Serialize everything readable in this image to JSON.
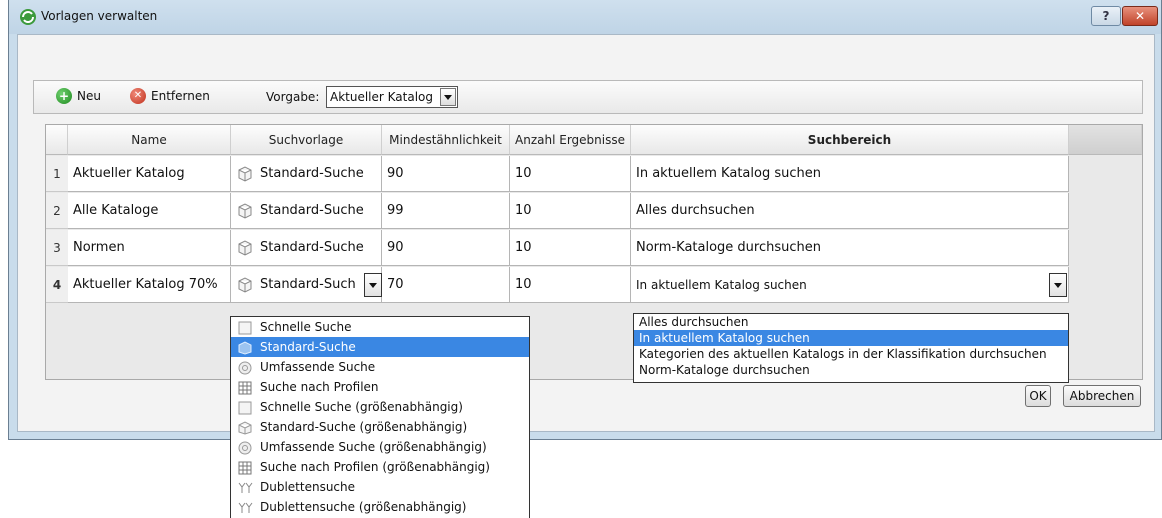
{
  "window": {
    "title": "Vorlagen verwalten",
    "help_label": "?",
    "close_label": "✕"
  },
  "toolbar": {
    "new_label": "Neu",
    "remove_label": "Entfernen",
    "vorgabe_label": "Vorgabe:",
    "vorgabe_value": "Aktueller Katalog"
  },
  "table": {
    "columns": [
      "Name",
      "Suchvorlage",
      "Mindestähnlichkeit",
      "Anzahl Ergebnisse",
      "Suchbereich"
    ],
    "rows": [
      {
        "num": "1",
        "name": "Aktueller Katalog",
        "template": "Standard-Suche",
        "min": "90",
        "count": "10",
        "scope": "In aktuellem Katalog suchen"
      },
      {
        "num": "2",
        "name": "Alle Kataloge",
        "template": "Standard-Suche",
        "min": "99",
        "count": "10",
        "scope": "Alles durchsuchen"
      },
      {
        "num": "3",
        "name": "Normen",
        "template": "Standard-Suche",
        "min": "90",
        "count": "10",
        "scope": "Norm-Kataloge durchsuchen"
      },
      {
        "num": "4",
        "name": "Aktueller Katalog 70%",
        "template": "Standard-Such",
        "min": "70",
        "count": "10",
        "scope": "In aktuellem Katalog suchen"
      }
    ]
  },
  "template_dropdown": {
    "options": [
      "Schnelle Suche",
      "Standard-Suche",
      "Umfassende Suche",
      "Suche nach Profilen",
      "Schnelle Suche (größenabhängig)",
      "Standard-Suche (größenabhängig)",
      "Umfassende Suche (größenabhängig)",
      "Suche nach Profilen (größenabhängig)",
      "Dublettensuche",
      "Dublettensuche (größenabhängig)"
    ],
    "selected": "Standard-Suche"
  },
  "scope_dropdown": {
    "options": [
      "Alles durchsuchen",
      "In aktuellem Katalog suchen",
      "Kategorien des aktuellen Katalogs in der Klassifikation durchsuchen",
      "Norm-Kataloge durchsuchen"
    ],
    "selected": "In aktuellem Katalog suchen"
  },
  "buttons": {
    "ok": "OK",
    "cancel": "Abbrechen"
  },
  "colors": {
    "selection": "#3a87e3",
    "title_bar": "#c9dceb"
  }
}
